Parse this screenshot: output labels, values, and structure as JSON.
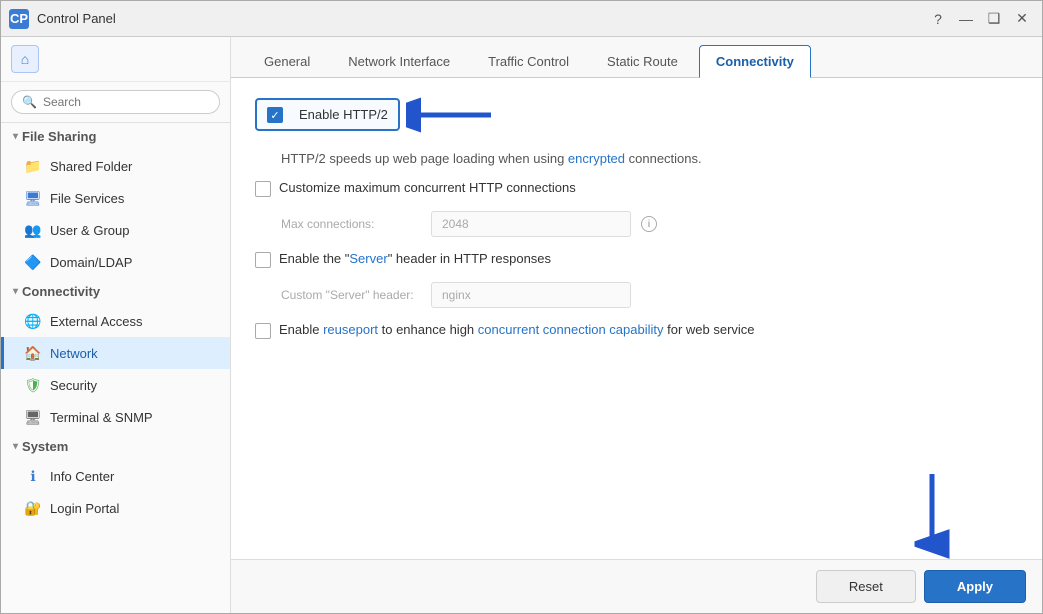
{
  "window": {
    "title": "Control Panel",
    "icon": "CP"
  },
  "titlebar": {
    "help_label": "?",
    "minimize_label": "—",
    "maximize_label": "❑",
    "close_label": "✕"
  },
  "sidebar": {
    "search_placeholder": "Search",
    "home_icon": "⌂",
    "sections": [
      {
        "name": "file-sharing",
        "label": "File Sharing",
        "expanded": true,
        "items": [
          {
            "id": "shared-folder",
            "label": "Shared Folder",
            "icon": "📁",
            "icon_class": "icon-folder"
          },
          {
            "id": "file-services",
            "label": "File Services",
            "icon": "🖥",
            "icon_class": "icon-file"
          },
          {
            "id": "user-group",
            "label": "User & Group",
            "icon": "👥",
            "icon_class": "icon-user"
          },
          {
            "id": "domain-ldap",
            "label": "Domain/LDAP",
            "icon": "🔷",
            "icon_class": "icon-domain"
          }
        ]
      },
      {
        "name": "connectivity",
        "label": "Connectivity",
        "expanded": true,
        "items": [
          {
            "id": "external-access",
            "label": "External Access",
            "icon": "🌐",
            "icon_class": "icon-access"
          },
          {
            "id": "network",
            "label": "Network",
            "icon": "🏠",
            "icon_class": "icon-network",
            "active": true
          },
          {
            "id": "security",
            "label": "Security",
            "icon": "🛡",
            "icon_class": "icon-security"
          },
          {
            "id": "terminal-snmp",
            "label": "Terminal & SNMP",
            "icon": "🖥",
            "icon_class": "icon-terminal"
          }
        ]
      },
      {
        "name": "system",
        "label": "System",
        "expanded": true,
        "items": [
          {
            "id": "info-center",
            "label": "Info Center",
            "icon": "ℹ",
            "icon_class": "icon-info"
          },
          {
            "id": "login-portal",
            "label": "Login Portal",
            "icon": "🔐",
            "icon_class": "icon-login"
          }
        ]
      }
    ]
  },
  "tabs": [
    {
      "id": "general",
      "label": "General"
    },
    {
      "id": "network-interface",
      "label": "Network Interface"
    },
    {
      "id": "traffic-control",
      "label": "Traffic Control"
    },
    {
      "id": "static-route",
      "label": "Static Route"
    },
    {
      "id": "connectivity",
      "label": "Connectivity",
      "active": true
    }
  ],
  "content": {
    "enable_http2": {
      "label": "Enable HTTP/2",
      "checked": true,
      "description": "HTTP/2 speeds up web page loading when using encrypted connections."
    },
    "customize_connections": {
      "label": "Customize maximum concurrent HTTP connections",
      "checked": false
    },
    "max_connections": {
      "label": "Max connections:",
      "value": "2048",
      "placeholder": "2048"
    },
    "enable_server_header": {
      "label": "Enable the \"Server\" header in HTTP responses",
      "checked": false
    },
    "custom_server_header": {
      "label": "Custom \"Server\" header:",
      "value": "nginx",
      "placeholder": "nginx"
    },
    "enable_reuseport": {
      "label": "Enable reuseport to enhance high concurrent connection capability for web service",
      "checked": false
    }
  },
  "footer": {
    "reset_label": "Reset",
    "apply_label": "Apply"
  }
}
